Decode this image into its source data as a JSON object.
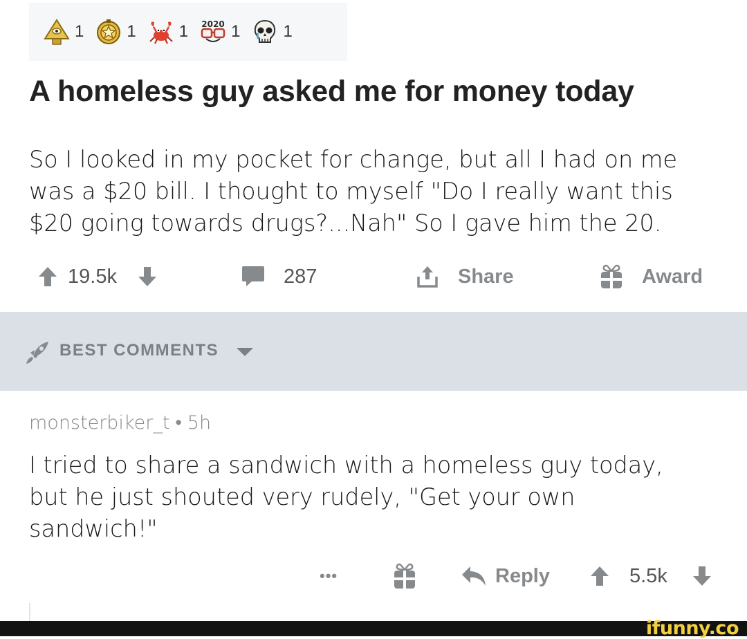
{
  "awards": [
    {
      "icon": "eye-pyramid-award-icon",
      "count": "1"
    },
    {
      "icon": "gold-star-award-icon",
      "count": "1"
    },
    {
      "icon": "crab-award-icon",
      "count": "1"
    },
    {
      "icon": "2020-glasses-award-icon",
      "count": "1"
    },
    {
      "icon": "crying-skull-award-icon",
      "count": "1"
    }
  ],
  "post": {
    "title": "A homeless guy asked me for money today",
    "body_lines": [
      "So I looked in my pocket for change, but all I had on me",
      "was a $20 bill.  I thought to myself \"Do I really want this",
      "$20 going towards drugs?...Nah\" So I gave him the 20."
    ],
    "votes": "19.5k",
    "comments": "287",
    "share_label": "Share",
    "award_label": "Award"
  },
  "sort": {
    "label": "BEST COMMENTS"
  },
  "comment": {
    "author": "monsterbiker_t",
    "separator": "•",
    "age": "5h",
    "body_lines": [
      "I tried to share a sandwich with a homeless guy today,",
      "but he just shouted very rudely, \"Get your own",
      "sandwich!\""
    ],
    "more_label": "•••",
    "reply_label": "Reply",
    "votes": "5.5k"
  },
  "watermark": "ifunny.co",
  "colors": {
    "icon_gray": "#878a8c",
    "banner_bg": "#dae0e6",
    "watermark_yellow": "#f4d03f"
  }
}
